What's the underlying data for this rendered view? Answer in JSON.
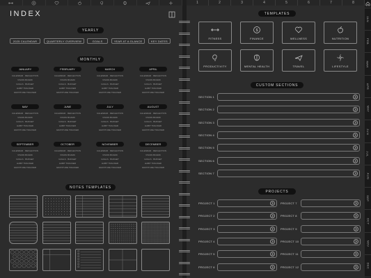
{
  "top_icons": [
    "dumbbell-icon",
    "dollar-icon",
    "heart-icon",
    "apple-icon",
    "lightbulb-icon",
    "brain-icon",
    "plane-icon",
    "flower-icon"
  ],
  "top_tabs": [
    "1",
    "2",
    "3",
    "4",
    "5",
    "6",
    "7",
    "8"
  ],
  "left": {
    "title": "INDEX",
    "yearly_heading": "YEARLY",
    "yearly_buttons": [
      "2025 CALENDAR",
      "QUARTERLY OVERVIEW",
      "GOALS",
      "YEAR AT A GLANCE",
      "KEY DATES"
    ],
    "monthly_heading": "MONTHLY",
    "months": [
      "JANUARY",
      "FEBRUARY",
      "MARCH",
      "APRIL",
      "MAY",
      "JUNE",
      "JULY",
      "AUGUST",
      "SEPTEMBER",
      "OCTOBER",
      "NOVEMBER",
      "DECEMBER"
    ],
    "month_links": [
      "CALENDAR  ·  REFLECTION",
      "VISION BOARD",
      "GOALS  ·  BUDGET",
      "HABIT TRACKER",
      "GRATITUDE TRACKER"
    ],
    "notes_heading": "NOTES TEMPLATES"
  },
  "right": {
    "templates_heading": "TEMPLATES",
    "templates": [
      {
        "label": "FITNESS",
        "icon": "dumbbell-icon"
      },
      {
        "label": "FINANCE",
        "icon": "dollar-icon"
      },
      {
        "label": "WELLNESS",
        "icon": "heart-icon"
      },
      {
        "label": "NUTRITION",
        "icon": "apple-icon"
      },
      {
        "label": "PRODUCTIVITY",
        "icon": "lightbulb-icon"
      },
      {
        "label": "MENTAL HEALTH",
        "icon": "brain-icon"
      },
      {
        "label": "TRAVEL",
        "icon": "plane-icon"
      },
      {
        "label": "LIFESTYLE",
        "icon": "flower-icon"
      }
    ],
    "custom_heading": "CUSTOM SECTIONS",
    "sections": [
      "SECTION 1",
      "SECTION 2",
      "SECTION 3",
      "SECTION 4",
      "SECTION 5",
      "SECTION 6",
      "SECTION 7"
    ],
    "projects_heading": "PROJECTS",
    "projects_left": [
      "PROJECT 1",
      "PROJECT 2",
      "PROJECT 3",
      "PROJECT 4",
      "PROJECT 5",
      "PROJECT 6"
    ],
    "projects_right": [
      "PROJECT 7",
      "PROJECT 8",
      "PROJECT 9",
      "PROJECT 10",
      "PROJECT 11",
      "PROJECT 12"
    ]
  },
  "side_tabs": [
    "JAN",
    "FEB",
    "MAR",
    "APR",
    "MAY",
    "JUN",
    "JUL",
    "AUG",
    "SEP",
    "OCT",
    "NOV",
    "DEC"
  ]
}
